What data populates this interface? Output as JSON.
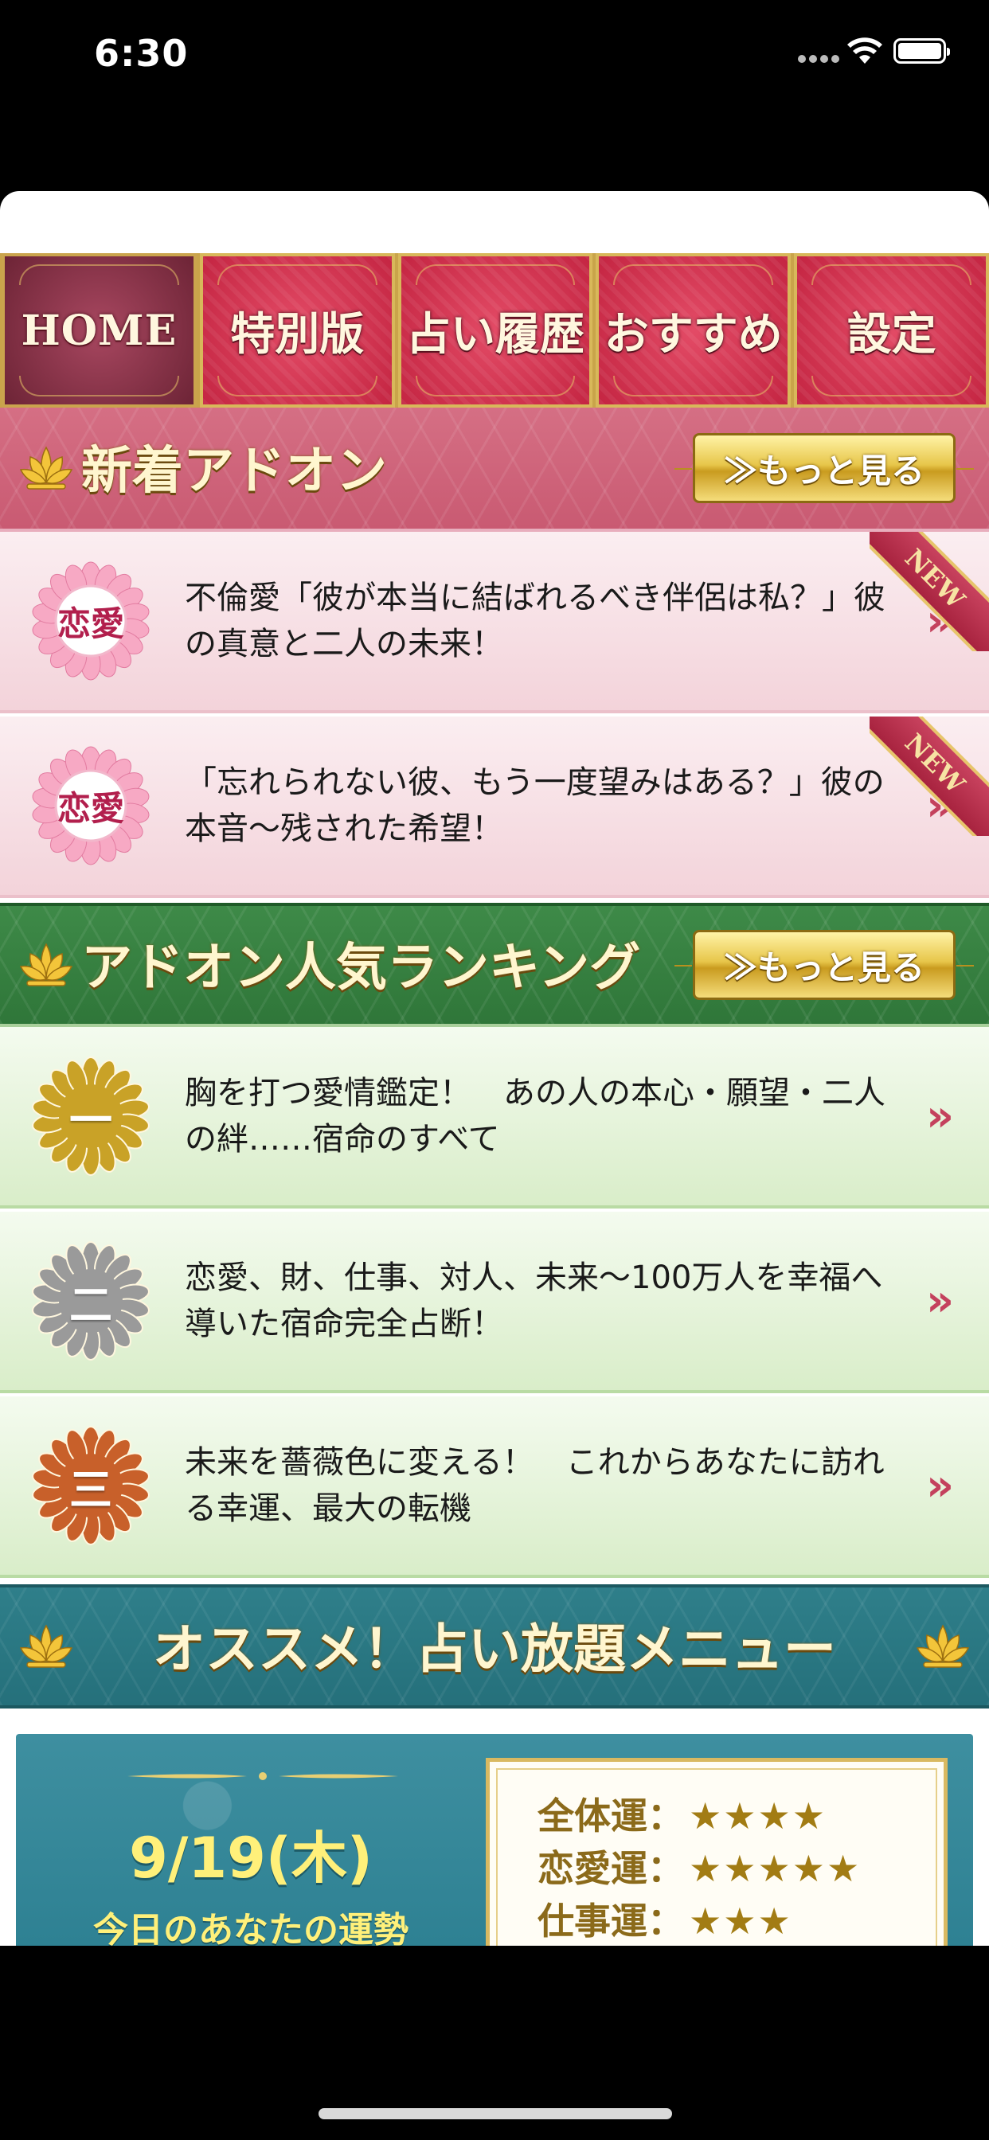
{
  "status_bar": {
    "time": "6:30"
  },
  "tabs": [
    {
      "label": "HOME",
      "active": true
    },
    {
      "label": "特別版",
      "active": false
    },
    {
      "label": "占い履歴",
      "active": false
    },
    {
      "label": "おすすめ",
      "active": false
    },
    {
      "label": "設定",
      "active": false
    }
  ],
  "new_addons": {
    "title": "新着アドオン",
    "more_label": "≫もっと見る",
    "items": [
      {
        "badge": "恋愛",
        "text": "不倫愛「彼が本当に結ばれるべき伴侶は私？」彼の真意と二人の未来！",
        "tag": "NEW"
      },
      {
        "badge": "恋愛",
        "text": "「忘れられない彼、もう一度望みはある？」彼の本音〜残された希望！",
        "tag": "NEW"
      }
    ]
  },
  "ranking": {
    "title": "アドオン人気ランキング",
    "more_label": "≫もっと見る",
    "items": [
      {
        "rank": "一",
        "color": "#c9a227",
        "text": "胸を打つ愛情鑑定！　あの人の本心・願望・二人の絆……宿命のすべて"
      },
      {
        "rank": "二",
        "color": "#9a9a9a",
        "text": "恋愛、財、仕事、対人、未来〜100万人を幸福へ導いた宿命完全占断！"
      },
      {
        "rank": "三",
        "color": "#c8602a",
        "text": "未来を薔薇色に変える！　これからあなたに訪れる幸運、最大の転機"
      }
    ]
  },
  "unlimited": {
    "title": "オススメ！占い放題メニュー"
  },
  "today": {
    "date": "9/19(木)",
    "subtitle": "今日のあなたの運勢",
    "luck": [
      {
        "label": "全体運：",
        "stars": "★★★★",
        "rating": 4
      },
      {
        "label": "恋愛運：",
        "stars": "★★★★★",
        "rating": 5
      },
      {
        "label": "仕事運：",
        "stars": "★★★",
        "rating": 3
      }
    ]
  },
  "icons": {
    "chevron": "»",
    "lotus": "lotus-icon",
    "wifi": "wifi-icon",
    "battery": "battery-icon"
  },
  "colors": {
    "pink_accent": "#c95a72",
    "green_accent": "#2f7639",
    "teal_accent": "#2c7f91",
    "gold": "#e7c64a"
  }
}
